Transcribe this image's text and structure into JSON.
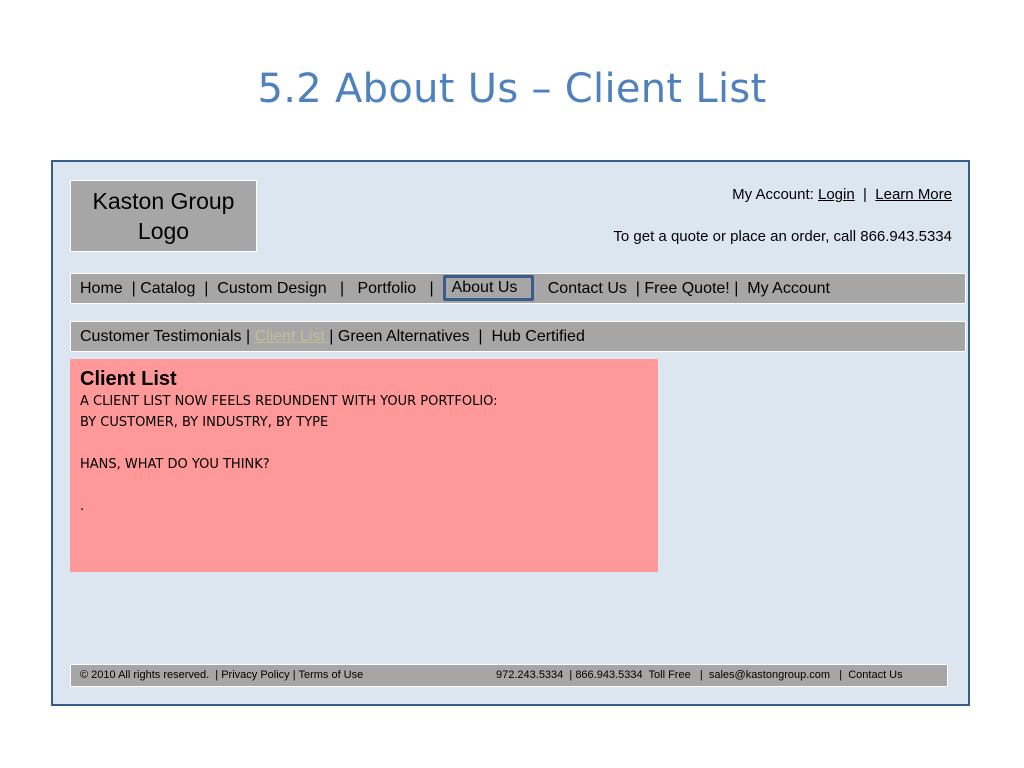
{
  "slide": {
    "title": "5.2 About Us – Client List"
  },
  "header": {
    "logo_text_line1": "Kaston Group",
    "logo_text_line2": "Logo",
    "account_label": "My Account: ",
    "login_link": "Login",
    "separator": "  |  ",
    "learn_more_link": "Learn More",
    "quote_text": "To get a quote or place an order, call 866.943.5334"
  },
  "nav": {
    "items": [
      {
        "label": "Home",
        "sep": "  | "
      },
      {
        "label": "Catalog",
        "sep": "  |  "
      },
      {
        "label": "Custom Design",
        "sep": "   |   "
      },
      {
        "label": "Portfolio",
        "sep": "   |  "
      },
      {
        "label": "About Us",
        "sep": "   "
      },
      {
        "label": "Contact Us",
        "sep": "  | "
      },
      {
        "label": "Free Quote!",
        "sep": " |  "
      },
      {
        "label": "My Account",
        "sep": ""
      }
    ],
    "active": "About Us"
  },
  "subnav": {
    "items": [
      {
        "label": "Customer Testimonials",
        "sep": " | "
      },
      {
        "label": "Client List ",
        "sep": "| "
      },
      {
        "label": "Green Alternatives",
        "sep": "  |  "
      },
      {
        "label": "Hub Certified",
        "sep": ""
      }
    ],
    "current": "Client List "
  },
  "content": {
    "heading": "Client List",
    "line1": "A CLIENT LIST NOW FEELS REDUNDENT WITH YOUR PORTFOLIO:",
    "line2": "BY CUSTOMER, BY INDUSTRY, BY TYPE",
    "line3": "HANS, WHAT DO YOU THINK?",
    "line4": ".",
    "background": "#ff9999"
  },
  "footer": {
    "copyright": "© 2010 All rights reserved.  | ",
    "privacy": "Privacy Policy",
    "sep1": " | ",
    "terms": "Terms of Use",
    "phones": "972.243.5334  | 866.943.5334  Toll Free   |  ",
    "email": "sales@kastongroup.com",
    "sep2": "   |  ",
    "contact": "Contact Us"
  },
  "colors": {
    "title": "#4f81bd",
    "frame_bg": "#dce6f1",
    "frame_border": "#385d8a",
    "bars": "#a6a6a6",
    "current_link": "#c4bd97"
  }
}
